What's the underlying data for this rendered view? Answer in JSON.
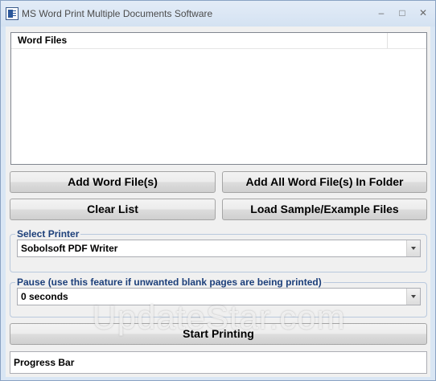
{
  "window": {
    "title": "MS Word Print Multiple Documents Software",
    "controls": {
      "minimize": "–",
      "maximize": "□",
      "close": "✕"
    }
  },
  "file_list": {
    "column_header": "Word Files",
    "items": []
  },
  "buttons": {
    "add_files": "Add Word File(s)",
    "add_folder": "Add All Word File(s) In Folder",
    "clear_list": "Clear List",
    "load_sample": "Load Sample/Example Files",
    "start_printing": "Start Printing"
  },
  "printer": {
    "label": "Select Printer",
    "selected": "Sobolsoft PDF Writer"
  },
  "pause": {
    "label": "Pause (use this feature if unwanted blank pages are being printed)",
    "selected": "0 seconds"
  },
  "progress": {
    "text": "Progress Bar"
  },
  "watermark": "UpdateStar.com",
  "icons": {
    "app": "word-document-icon",
    "dropdown": "chevron-down-icon"
  }
}
